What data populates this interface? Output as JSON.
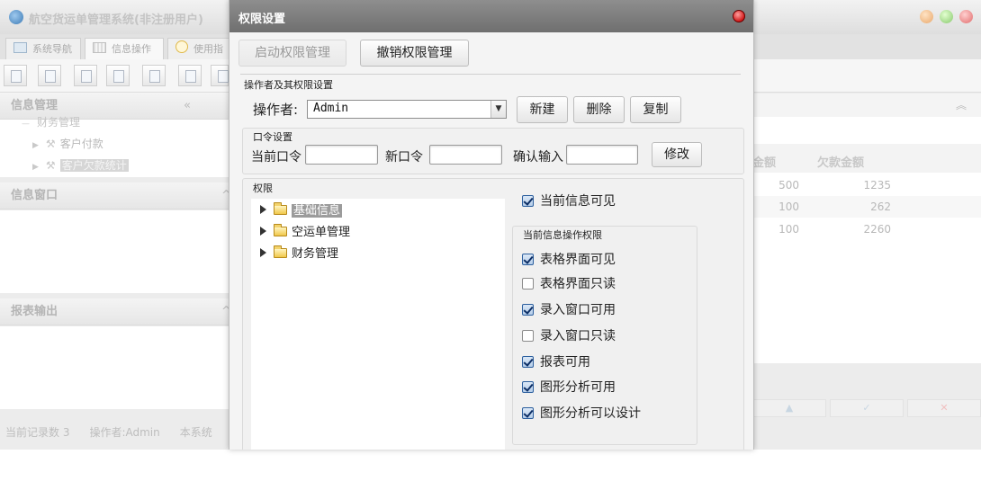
{
  "app": {
    "title": "航空货运单管理系统(非注册用户)",
    "tabs": [
      {
        "label": "系统导航",
        "icon": "monitor-icon"
      },
      {
        "label": "信息操作",
        "icon": "grid-icon"
      },
      {
        "label": "使用指",
        "icon": "help-circle-icon"
      }
    ],
    "panels": {
      "info_manage": "信息管理",
      "info_window": "信息窗口",
      "report_output": "报表输出"
    },
    "tree": {
      "partial_header": "财务管理",
      "items": [
        "客户付款",
        "客户欠款统计"
      ]
    },
    "grid": {
      "columns": [
        "金额",
        "欠款金额"
      ],
      "rows": [
        {
          "amount": "500",
          "owed": "1235"
        },
        {
          "amount": "100",
          "owed": "262"
        },
        {
          "amount": "100",
          "owed": "2260"
        }
      ]
    },
    "status": {
      "record_count": "当前记录数 3",
      "operator": "操作者:Admin",
      "system": "本系统"
    }
  },
  "dialog": {
    "title": "权限设置",
    "enable_btn": "启动权限管理",
    "revoke_btn": "撤销权限管理",
    "operator_section": "操作者及其权限设置",
    "operator_label": "操作者:",
    "operator_value": "Admin",
    "new_btn": "新建",
    "delete_btn": "删除",
    "copy_btn": "复制",
    "password_section": "口令设置",
    "current_pwd_label": "当前口令",
    "new_pwd_label": "新口令",
    "confirm_label": "确认输入",
    "modify_btn": "修改",
    "permission_section": "权限",
    "tree": [
      "基础信息",
      "空运单管理",
      "财务管理"
    ],
    "current_visible": {
      "label": "当前信息可见",
      "checked": true
    },
    "ops_section": "当前信息操作权限",
    "ops": [
      {
        "label": "表格界面可见",
        "checked": true
      },
      {
        "label": "表格界面只读",
        "checked": false
      },
      {
        "label": "录入窗口可用",
        "checked": true
      },
      {
        "label": "录入窗口只读",
        "checked": false
      },
      {
        "label": "报表可用",
        "checked": true
      },
      {
        "label": "图形分析可用",
        "checked": true
      },
      {
        "label": "图形分析可以设计",
        "checked": true
      }
    ]
  }
}
